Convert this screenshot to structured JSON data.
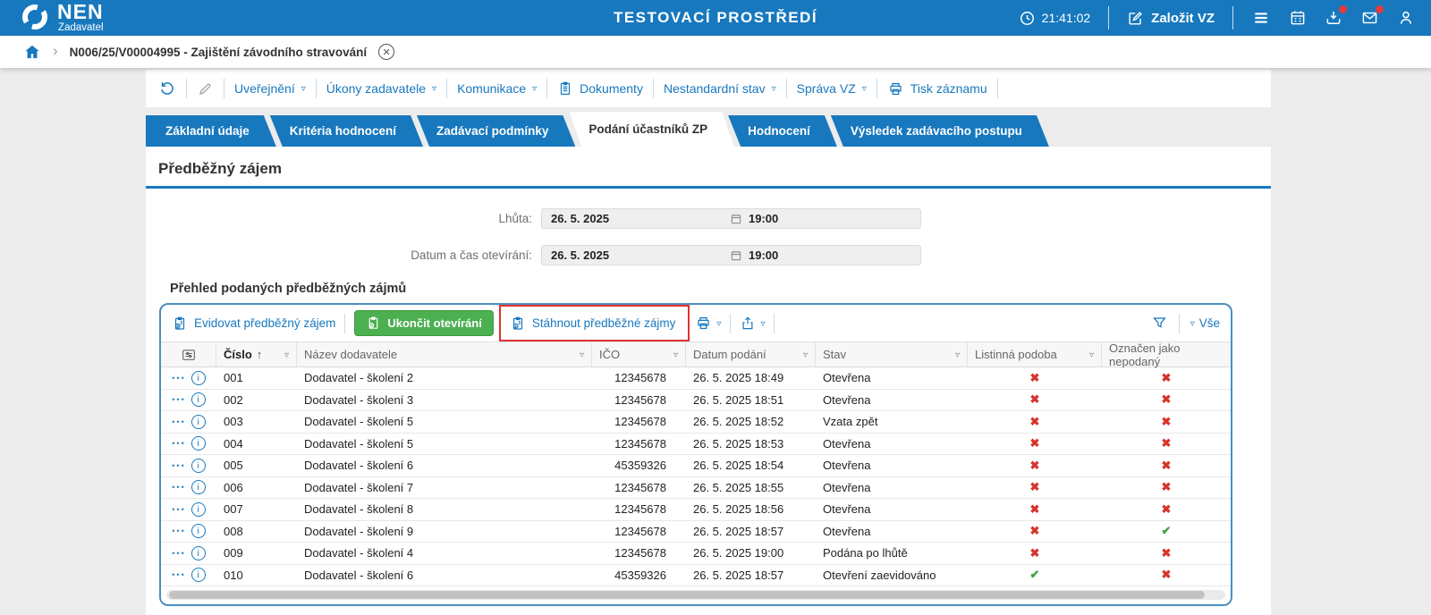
{
  "colors": {
    "accent_blue": "#1778be",
    "panel_border_blue": "#4b8fc0",
    "button_green": "#4caf50",
    "cross_red": "#d6342c",
    "check_green": "#3fa33f",
    "annotation_red": "#e03131",
    "badge_red": "#e5383b"
  },
  "topbar": {
    "logo_text": "NEN",
    "logo_sub": "Zadavatel",
    "environment_title": "TESTOVACÍ PROSTŘEDÍ",
    "clock": "21:41:02",
    "create_vz_label": "Založit VZ",
    "icons": [
      "clock-icon",
      "edit-square-icon",
      "hamburger-menu-icon",
      "calendar-icon",
      "download-icon",
      "mail-icon",
      "user-icon"
    ]
  },
  "breadcrumb": {
    "item": "N006/25/V00004995 - Zajištění závodního stravování"
  },
  "record_toolbar": {
    "items": [
      {
        "label": "Uveřejnění",
        "dropdown": true
      },
      {
        "label": "Úkony zadavatele",
        "dropdown": true
      },
      {
        "label": "Komunikace",
        "dropdown": true
      },
      {
        "label": "Dokumenty",
        "dropdown": false,
        "icon": "document-icon"
      },
      {
        "label": "Nestandardní stav",
        "dropdown": true
      },
      {
        "label": "Správa VZ",
        "dropdown": true
      },
      {
        "label": "Tisk záznamu",
        "dropdown": false,
        "icon": "printer-icon"
      }
    ]
  },
  "tabs": [
    {
      "label": "Základní údaje",
      "active": false
    },
    {
      "label": "Kritéria hodnocení",
      "active": false
    },
    {
      "label": "Zadávací podmínky",
      "active": false
    },
    {
      "label": "Podání účastníků ZP",
      "active": true
    },
    {
      "label": "Hodnocení",
      "active": false
    },
    {
      "label": "Výsledek zadávacího postupu",
      "active": false
    }
  ],
  "section": {
    "title": "Předběžný zájem"
  },
  "form": {
    "fields": [
      {
        "label": "Lhůta:",
        "date": "26. 5. 2025",
        "time": "19:00"
      },
      {
        "label": "Datum a čas otevírání:",
        "date": "26. 5. 2025",
        "time": "19:00"
      }
    ]
  },
  "table_section": {
    "title": "Přehled podaných předběžných zájmů",
    "toolbar": {
      "evidovat_label": "Evidovat předběžný zájem",
      "ukoncit_label": "Ukončit otevírání",
      "stahnout_label": "Stáhnout předběžné zájmy",
      "vse_label": "Vše"
    },
    "columns": [
      "Číslo",
      "Název dodavatele",
      "IČO",
      "Datum podání",
      "Stav",
      "Listinná podoba",
      "Označen jako nepodaný"
    ],
    "sort": {
      "column": "Číslo",
      "direction": "asc"
    },
    "rows": [
      {
        "cislo": "001",
        "nazev": "Dodavatel - školení 2",
        "ico": "12345678",
        "datum": "26. 5. 2025 18:49",
        "stav": "Otevřena",
        "listinna": false,
        "nepodany": false
      },
      {
        "cislo": "002",
        "nazev": "Dodavatel - školení 3",
        "ico": "12345678",
        "datum": "26. 5. 2025 18:51",
        "stav": "Otevřena",
        "listinna": false,
        "nepodany": false
      },
      {
        "cislo": "003",
        "nazev": "Dodavatel - školení 5",
        "ico": "12345678",
        "datum": "26. 5. 2025 18:52",
        "stav": "Vzata zpět",
        "listinna": false,
        "nepodany": false
      },
      {
        "cislo": "004",
        "nazev": "Dodavatel - školení 5",
        "ico": "12345678",
        "datum": "26. 5. 2025 18:53",
        "stav": "Otevřena",
        "listinna": false,
        "nepodany": false
      },
      {
        "cislo": "005",
        "nazev": "Dodavatel - školení 6",
        "ico": "45359326",
        "datum": "26. 5. 2025 18:54",
        "stav": "Otevřena",
        "listinna": false,
        "nepodany": false
      },
      {
        "cislo": "006",
        "nazev": "Dodavatel - školení 7",
        "ico": "12345678",
        "datum": "26. 5. 2025 18:55",
        "stav": "Otevřena",
        "listinna": false,
        "nepodany": false
      },
      {
        "cislo": "007",
        "nazev": "Dodavatel - školení 8",
        "ico": "12345678",
        "datum": "26. 5. 2025 18:56",
        "stav": "Otevřena",
        "listinna": false,
        "nepodany": false
      },
      {
        "cislo": "008",
        "nazev": "Dodavatel - školení 9",
        "ico": "12345678",
        "datum": "26. 5. 2025 18:57",
        "stav": "Otevřena",
        "listinna": false,
        "nepodany": true
      },
      {
        "cislo": "009",
        "nazev": "Dodavatel - školení 4",
        "ico": "12345678",
        "datum": "26. 5. 2025 19:00",
        "stav": "Podána po lhůtě",
        "listinna": false,
        "nepodany": false
      },
      {
        "cislo": "010",
        "nazev": "Dodavatel - školení 6",
        "ico": "45359326",
        "datum": "26. 5. 2025 18:57",
        "stav": "Otevření zaevidováno",
        "listinna": true,
        "nepodany": false
      }
    ],
    "marks": {
      "yes": "✔",
      "no": "✖"
    }
  }
}
